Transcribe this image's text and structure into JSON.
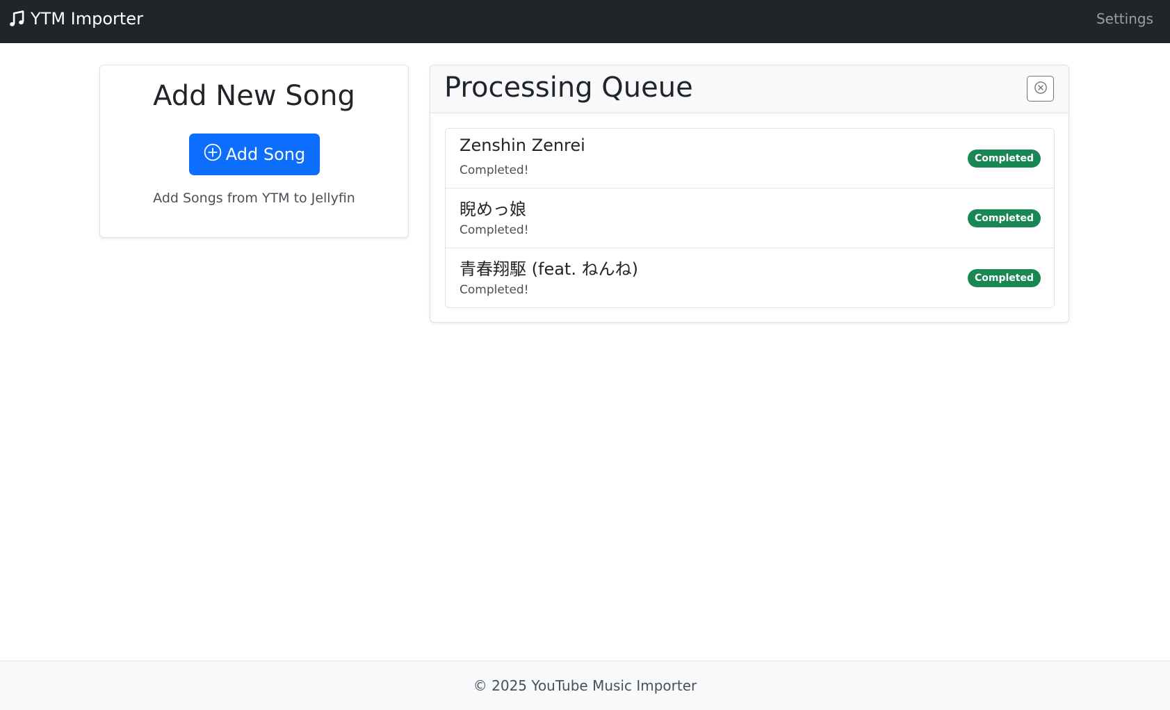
{
  "navbar": {
    "brand_icon": "music-note-icon",
    "brand_text": "YTM Importer",
    "settings_label": "Settings"
  },
  "add_card": {
    "title": "Add New Song",
    "button_icon": "plus-circle-icon",
    "button_label": "Add Song",
    "description": "Add Songs from YTM to Jellyfin"
  },
  "queue": {
    "title": "Processing Queue",
    "clear_icon": "x-circle-icon",
    "items": [
      {
        "title": "Zenshin Zenrei",
        "status": "Completed!",
        "badge": "Completed"
      },
      {
        "title": "睨めっ娘",
        "status": "Completed!",
        "badge": "Completed"
      },
      {
        "title": "青春翔駆 (feat. ねんね)",
        "status": "Completed!",
        "badge": "Completed"
      }
    ]
  },
  "footer": {
    "text": "© 2025 YouTube Music Importer"
  },
  "colors": {
    "navbar_bg": "#212529",
    "primary": "#0d6efd",
    "success": "#198754",
    "footer_bg": "#f8f9fa"
  }
}
